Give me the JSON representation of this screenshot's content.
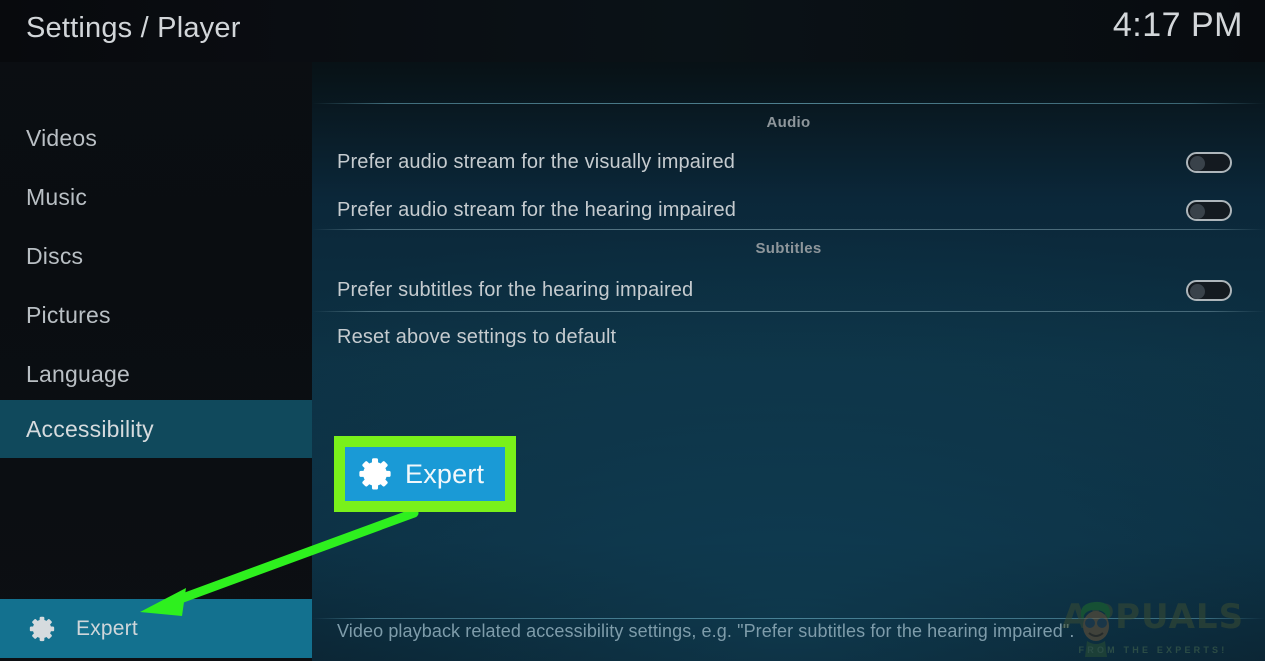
{
  "header": {
    "title": "Settings / Player",
    "clock": "4:17 PM"
  },
  "sidebar": {
    "items": [
      {
        "label": "Videos",
        "selected": false
      },
      {
        "label": "Music",
        "selected": false
      },
      {
        "label": "Discs",
        "selected": false
      },
      {
        "label": "Pictures",
        "selected": false
      },
      {
        "label": "Language",
        "selected": false
      },
      {
        "label": "Accessibility",
        "selected": true
      }
    ],
    "level_button": {
      "label": "Expert",
      "icon": "gear-icon",
      "background": "#13718f"
    }
  },
  "main": {
    "sections": [
      {
        "heading": "Audio",
        "rows": [
          {
            "label": "Prefer audio stream for the visually impaired",
            "control": "toggle",
            "value": "off"
          },
          {
            "label": "Prefer audio stream for the hearing impaired",
            "control": "toggle",
            "value": "off"
          }
        ]
      },
      {
        "heading": "Subtitles",
        "rows": [
          {
            "label": "Prefer subtitles for the hearing impaired",
            "control": "toggle",
            "value": "off"
          },
          {
            "label": "Reset above settings to default",
            "control": "none",
            "value": ""
          }
        ]
      }
    ],
    "description": "Video playback related accessibility settings, e.g. \"Prefer subtitles for the hearing impaired\"."
  },
  "annotation": {
    "callout": {
      "label": "Expert",
      "icon": "gear-icon",
      "border_color": "#79f11a",
      "fill_color": "#1a9ad6"
    },
    "arrow_color": "#2ef01e"
  },
  "watermark": {
    "brand": "APPUALS",
    "tagline": "FROM THE EXPERTS!"
  },
  "colors": {
    "sidebar_bg": "#0b0e12",
    "selected_bg": "#10495c",
    "content_bg": "#0d3143",
    "accent_teal": "#13718f",
    "text_primary": "#c5cbcf",
    "text_muted": "#8e969b",
    "description_text": "#7e9caa"
  }
}
